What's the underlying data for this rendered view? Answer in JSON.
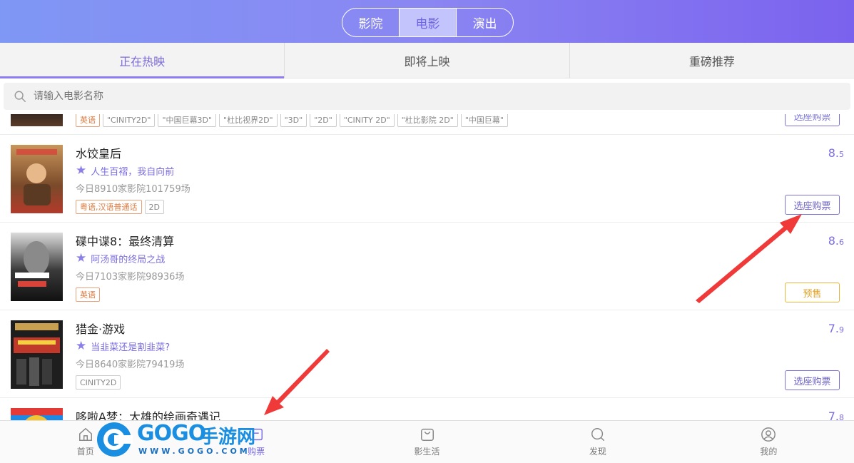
{
  "header": {
    "segments": [
      {
        "label": "影院",
        "active": false
      },
      {
        "label": "电影",
        "active": true
      },
      {
        "label": "演出",
        "active": false
      }
    ]
  },
  "tabs": [
    {
      "label": "正在热映",
      "active": true
    },
    {
      "label": "即将上映",
      "active": false
    },
    {
      "label": "重磅推荐",
      "active": false
    }
  ],
  "search": {
    "placeholder": "请输入电影名称"
  },
  "clipped_row": {
    "tags": [
      "英语",
      "\"CINITY2D\"",
      "\"中国巨幕3D\"",
      "\"杜比视界2D\"",
      "\"3D\"",
      "\"2D\"",
      "\"CINITY 2D\"",
      "\"杜比影院 2D\"",
      "\"中国巨幕\""
    ],
    "button": "选座购票"
  },
  "movies": [
    {
      "title": "水饺皇后",
      "slogan": "人生百褶，我自向前",
      "shows": "今日8910家影院101759场",
      "tags": [
        "粤语,汉语普通话",
        "2D"
      ],
      "score_int": "8.",
      "score_dec": "5",
      "button": "选座购票",
      "button_type": "buy",
      "poster_colors": [
        "#c8955a",
        "#7a4a2a",
        "#b33a2a"
      ]
    },
    {
      "title": "碟中谍8：最终清算",
      "slogan": "阿汤哥的终局之战",
      "shows": "今日7103家影院98936场",
      "tags": [
        "英语"
      ],
      "score_int": "8.",
      "score_dec": "6",
      "button": "预售",
      "button_type": "presale",
      "poster_colors": [
        "#dcdcdc",
        "#3a3a3a",
        "#111111"
      ]
    },
    {
      "title": "猎金·游戏",
      "slogan": "当韭菜还是割韭菜?",
      "shows": "今日8640家影院79419场",
      "tags": [
        "CINITY2D"
      ],
      "score_int": "7.",
      "score_dec": "9",
      "button": "选座购票",
      "button_type": "buy",
      "poster_colors": [
        "#2a2a2a",
        "#c0392b",
        "#1a1a1a"
      ]
    },
    {
      "title": "哆啦A梦：大雄的绘画奇遇记",
      "score_int": "7.",
      "score_dec": "8",
      "poster_colors": [
        "#1e88e5",
        "#f4c430",
        "#e53935"
      ]
    }
  ],
  "bottom_nav": [
    {
      "label": "首页",
      "icon": "home-icon",
      "active": false
    },
    {
      "label": "购票",
      "icon": "ticket-icon",
      "active": true
    },
    {
      "label": "影生活",
      "icon": "bag-icon",
      "active": false
    },
    {
      "label": "发现",
      "icon": "discover-icon",
      "active": false
    },
    {
      "label": "我的",
      "icon": "user-icon",
      "active": false
    }
  ],
  "watermark": {
    "brand": "GOGO",
    "brand_cn": "手游网",
    "url": "WWW.GOGO.COM"
  },
  "colors": {
    "accent": "#7b6ee0",
    "presale": "#e9b43c",
    "lang_tag": "#e07a3e",
    "arrow": "#f03a3a"
  }
}
